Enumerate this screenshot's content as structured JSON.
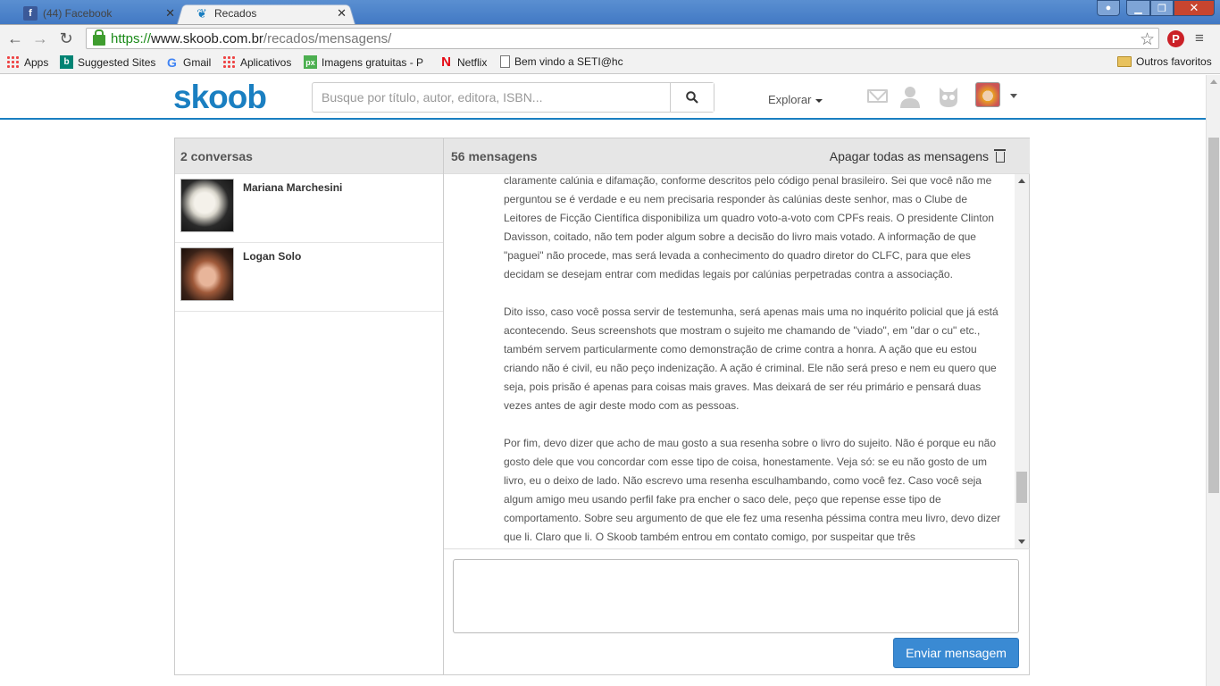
{
  "browser": {
    "tabs": [
      {
        "title": "(44) Facebook",
        "icon": "facebook-icon"
      },
      {
        "title": "Recados",
        "icon": "skoob-icon",
        "active": true
      }
    ],
    "url": {
      "scheme": "https://",
      "host": "www.skoob.com.br",
      "path": "/recados/mensagens/"
    },
    "bookmarks": [
      {
        "label": "Apps",
        "icon": "apps-grid-icon"
      },
      {
        "label": "Suggested Sites",
        "icon": "bing-icon"
      },
      {
        "label": "Gmail",
        "icon": "google-icon"
      },
      {
        "label": "Aplicativos",
        "icon": "apps-grid-icon"
      },
      {
        "label": "Imagens gratuitas - P",
        "icon": "pixabay-icon"
      },
      {
        "label": "Netflix",
        "icon": "netflix-icon"
      },
      {
        "label": "Bem vindo a SETI@hc",
        "icon": "document-icon"
      },
      {
        "label": "Outros favoritos",
        "icon": "folder-icon"
      }
    ]
  },
  "header": {
    "logo": "skoob",
    "search_placeholder": "Busque por título, autor, editora, ISBN...",
    "explore_label": "Explorar",
    "accent_color": "#1a7fc1"
  },
  "conversations": {
    "count_label": "2 conversas",
    "items": [
      {
        "name": "Mariana Marchesini"
      },
      {
        "name": "Logan Solo"
      }
    ]
  },
  "thread": {
    "count_label": "56 mensagens",
    "delete_all_label": "Apagar todas as mensagens",
    "paragraphs": [
      "claramente calúnia e difamação, conforme descritos pelo código penal brasileiro. Sei que você não me perguntou se é verdade e eu nem precisaria responder às calúnias deste senhor, mas o Clube de Leitores de Ficção Científica disponibiliza um quadro voto-a-voto com CPFs reais. O presidente Clinton Davisson, coitado, não tem poder algum sobre a decisão do livro mais votado. A informação de que \"paguei\" não procede, mas será levada a conhecimento do quadro diretor do CLFC, para que eles decidam se desejam entrar com medidas legais por calúnias perpetradas contra a associação.",
      "Dito isso, caso você possa servir de testemunha, será apenas mais uma no inquérito policial que já está acontecendo. Seus screenshots que mostram o sujeito me chamando de \"viado\", em \"dar o cu\" etc., também servem particularmente como demonstração de crime contra a honra. A ação que eu estou criando não é civil, eu não peço indenização. A ação é criminal. Ele não será preso e nem eu quero que seja, pois prisão é apenas para coisas mais graves. Mas deixará de ser réu primário e pensará duas vezes antes de agir deste modo com as pessoas.",
      "Por fim, devo dizer que acho de mau gosto a sua resenha sobre o livro do sujeito. Não é porque eu não gosto dele que vou concordar com esse tipo de coisa, honestamente. Veja só: se eu não gosto de um livro, eu o deixo de lado. Não escrevo uma resenha esculhambando, como você fez. Caso você seja algum amigo meu usando perfil fake pra encher o saco dele, peço que repense esse tipo de comportamento. Sobre seu argumento de que ele fez uma resenha péssima contra meu livro, devo dizer que li. Claro que li. O Skoob também entrou em contato comigo, por suspeitar que três"
    ],
    "reply_value": "",
    "send_label": "Enviar mensagem",
    "send_color": "#3a8ad3"
  }
}
